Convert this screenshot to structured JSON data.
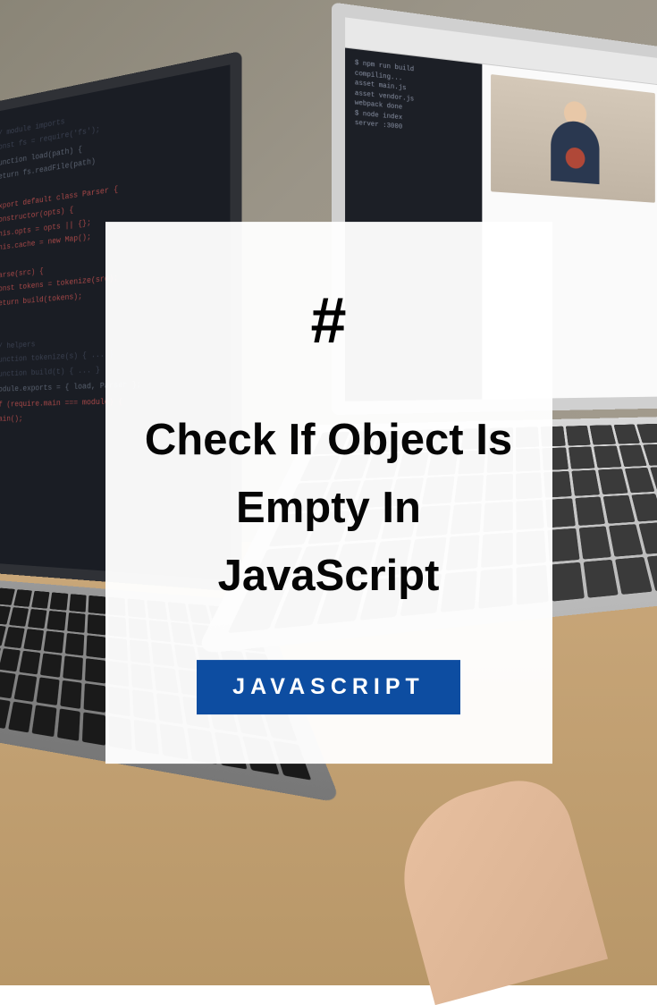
{
  "card": {
    "hash": "#",
    "title": "Check If Object Is Empty In JavaScript",
    "category": "JAVASCRIPT"
  },
  "colors": {
    "badge_bg": "#0d4da1",
    "badge_text": "#ffffff",
    "title_text": "#050505"
  }
}
